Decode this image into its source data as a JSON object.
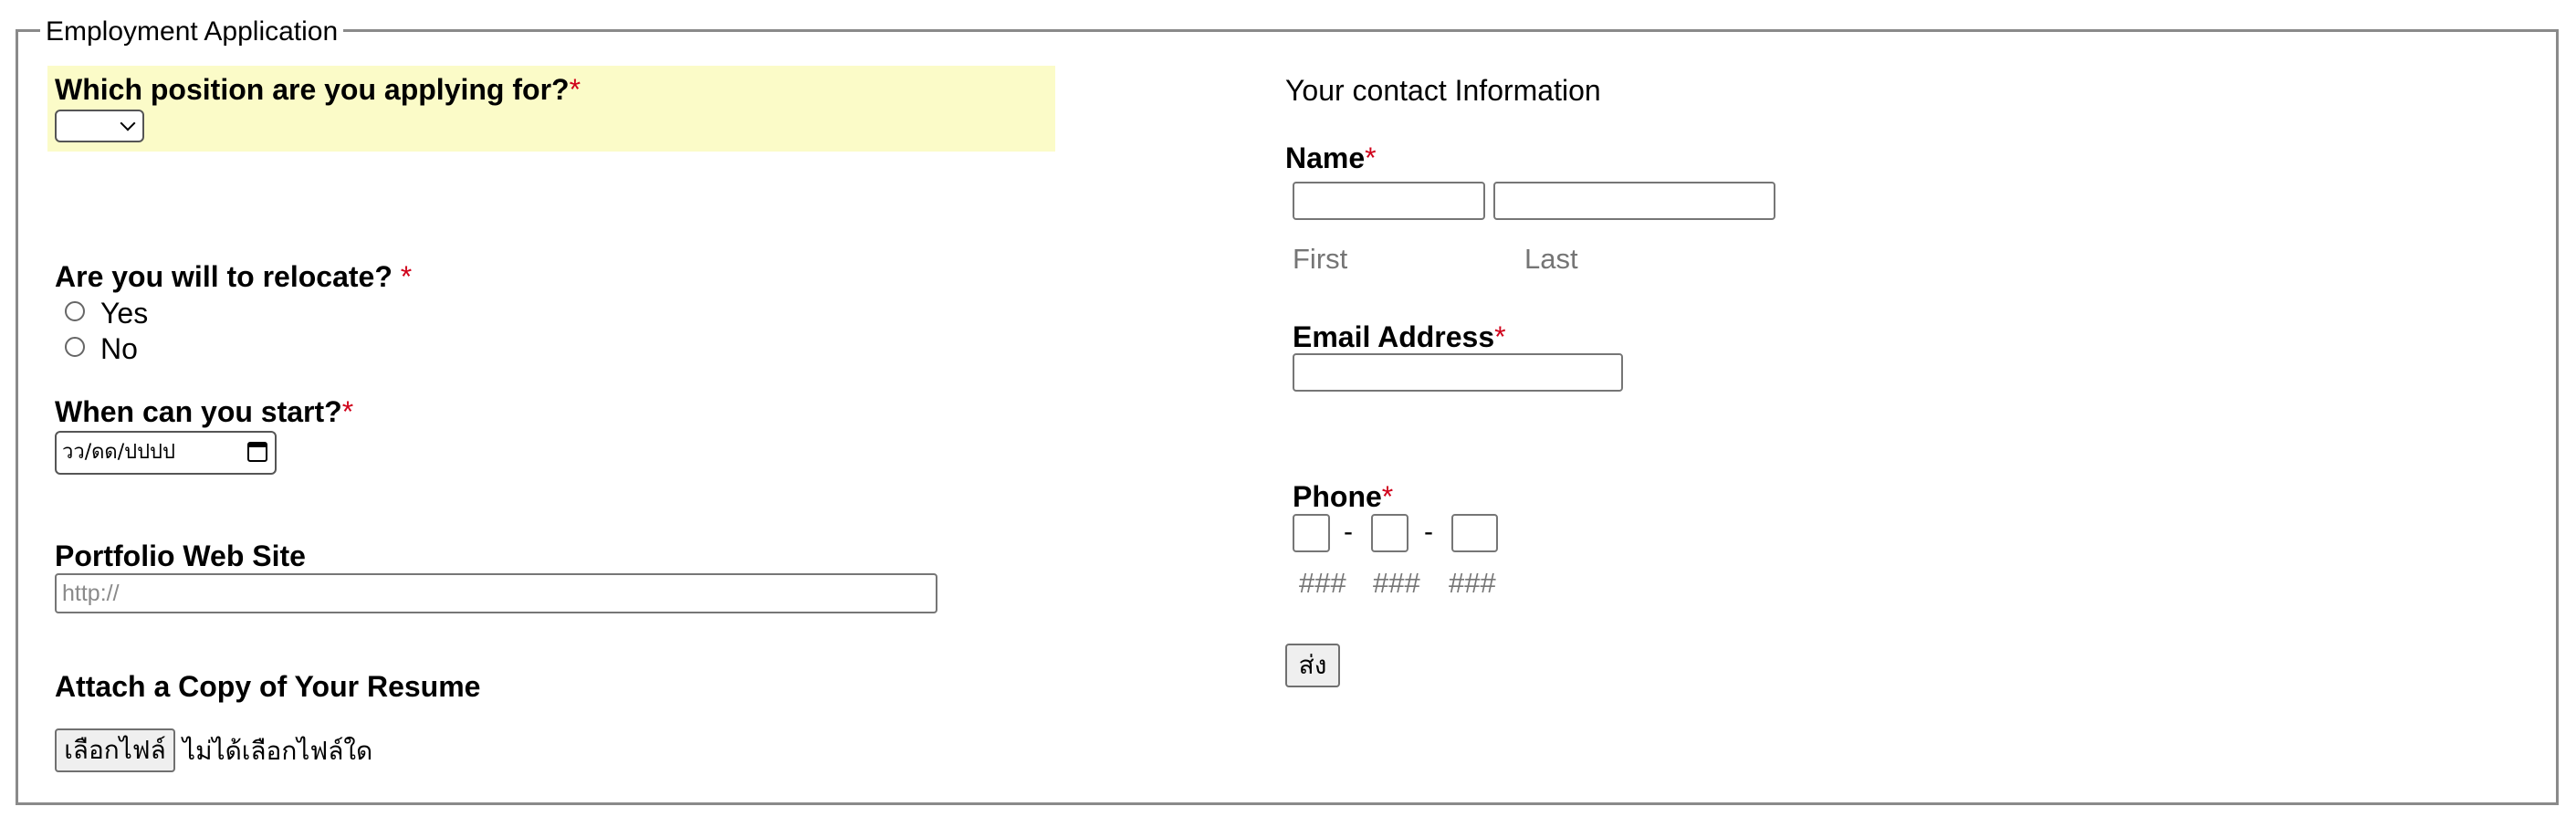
{
  "form": {
    "legend": "Employment Application",
    "required_mark": "*"
  },
  "left": {
    "position": {
      "label": "Which position are you applying for?",
      "selected": ""
    },
    "relocate": {
      "label": "Are you will to relocate? ",
      "options": [
        "Yes",
        "No"
      ]
    },
    "start": {
      "label": "When can you start?",
      "value": "วว/ดด/ปปปป"
    },
    "portfolio": {
      "label": "Portfolio Web Site",
      "placeholder": "http://"
    },
    "resume": {
      "label": "Attach a Copy of Your Resume",
      "button_label": "เลือกไฟล์",
      "status": "ไม่ได้เลือกไฟล์ใด"
    }
  },
  "right": {
    "heading": "Your contact Information",
    "name": {
      "label": "Name",
      "first_hint": "First",
      "last_hint": "Last"
    },
    "email": {
      "label": "Email Address"
    },
    "phone": {
      "label": "Phone",
      "separator": "-",
      "hints": [
        "###",
        "###",
        "###"
      ]
    },
    "submit_label": "ส่ง"
  },
  "colors": {
    "highlight": "#fbfbc8",
    "required": "#d0021b",
    "hint": "#757575",
    "border": "#8a8a8a"
  },
  "icons": {
    "select_arrow": "chevron-down-icon",
    "date_picker": "calendar-icon"
  }
}
